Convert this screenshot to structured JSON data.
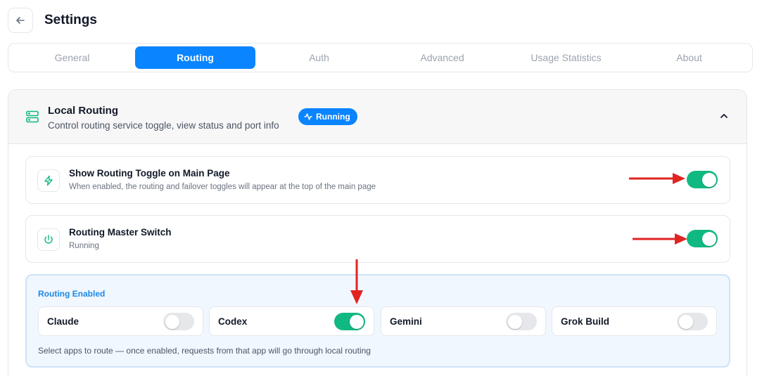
{
  "header": {
    "title": "Settings"
  },
  "tabs": [
    {
      "label": "General",
      "active": false
    },
    {
      "label": "Routing",
      "active": true
    },
    {
      "label": "Auth",
      "active": false
    },
    {
      "label": "Advanced",
      "active": false
    },
    {
      "label": "Usage Statistics",
      "active": false
    },
    {
      "label": "About",
      "active": false
    }
  ],
  "local_routing": {
    "title": "Local Routing",
    "description": "Control routing service toggle, view status and port info",
    "badge": "Running",
    "expanded": true
  },
  "show_toggle_card": {
    "title": "Show Routing Toggle on Main Page",
    "subtitle": "When enabled, the routing and failover toggles will appear at the top of the main page",
    "enabled": true
  },
  "master_switch_card": {
    "title": "Routing Master Switch",
    "subtitle": "Running",
    "enabled": true
  },
  "routing_enabled": {
    "label": "Routing Enabled",
    "apps": [
      {
        "name": "Claude",
        "enabled": false
      },
      {
        "name": "Codex",
        "enabled": true
      },
      {
        "name": "Gemini",
        "enabled": false
      },
      {
        "name": "Grok Build",
        "enabled": false
      }
    ],
    "footer": "Select apps to route — once enabled, requests from that app will go through local routing"
  },
  "colors": {
    "accent": "#0a84ff",
    "toggle_on": "#10b981",
    "annotation_arrow": "#e02424"
  },
  "icons": {
    "back": "arrow-left-icon",
    "section": "server-icon",
    "badge": "activity-icon",
    "collapse": "chevron-up-icon",
    "show_toggle": "zap-icon",
    "master_switch": "power-icon"
  }
}
